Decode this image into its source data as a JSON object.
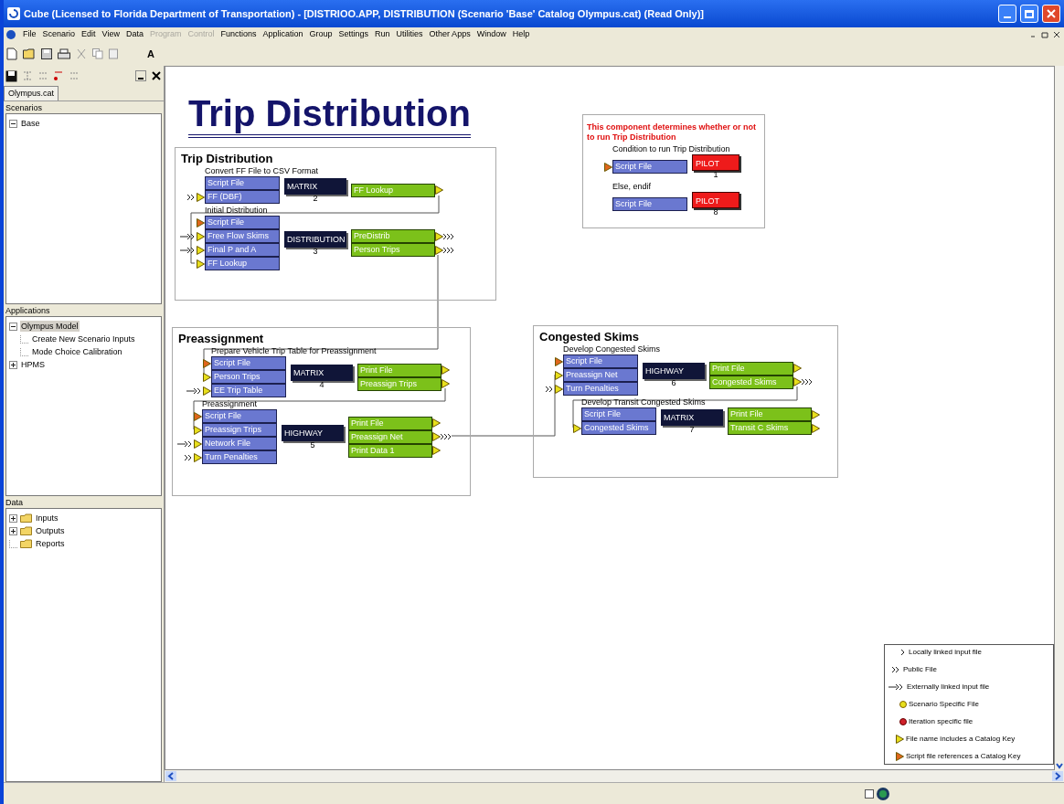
{
  "window": {
    "title": "Cube (Licensed to Florida Department of Transportation) - [DISTRIOO.APP, DISTRIBUTION (Scenario 'Base' Catalog Olympus.cat) (Read Only)]"
  },
  "menu": [
    {
      "label": "File",
      "disabled": false
    },
    {
      "label": "Scenario",
      "disabled": false
    },
    {
      "label": "Edit",
      "disabled": false
    },
    {
      "label": "View",
      "disabled": false
    },
    {
      "label": "Data",
      "disabled": false
    },
    {
      "label": "Program",
      "disabled": true
    },
    {
      "label": "Control",
      "disabled": true
    },
    {
      "label": "Functions",
      "disabled": false
    },
    {
      "label": "Application",
      "disabled": false
    },
    {
      "label": "Group",
      "disabled": false
    },
    {
      "label": "Settings",
      "disabled": false
    },
    {
      "label": "Run",
      "disabled": false
    },
    {
      "label": "Utilities",
      "disabled": false
    },
    {
      "label": "Other Apps",
      "disabled": false
    },
    {
      "label": "Window",
      "disabled": false
    },
    {
      "label": "Help",
      "disabled": false
    }
  ],
  "toolbar": {
    "font_button": "A"
  },
  "side_panel": {
    "tab": "Olympus.cat",
    "sections": [
      {
        "title": "Scenarios",
        "items": [
          {
            "label": "Base",
            "expanded": true,
            "selected": false
          }
        ]
      },
      {
        "title": "Applications",
        "items": [
          {
            "label": "Olympus Model",
            "expanded": true,
            "selected": true,
            "children": [
              {
                "label": "Create New Scenario Inputs",
                "selected": false
              },
              {
                "label": "Mode Choice Calibration",
                "selected": false
              }
            ]
          },
          {
            "label": "HPMS",
            "expanded": false,
            "selected": false
          }
        ]
      },
      {
        "title": "Data",
        "items": [
          {
            "label": "Inputs",
            "expanded": false,
            "selected": false
          },
          {
            "label": "Outputs",
            "expanded": false,
            "selected": false
          },
          {
            "label": "Reports",
            "selected": false
          }
        ]
      }
    ]
  },
  "canvas": {
    "title": "Trip Distribution",
    "groups": [
      {
        "title": "Trip Distribution",
        "steps": [
          {
            "caption": "Convert FF File to CSV Format",
            "inputs": [
              {
                "label": "Script File",
                "kind": "none"
              },
              {
                "label": "FF (DBF)",
                "kind": "public-key"
              }
            ],
            "program": {
              "name": "MATRIX",
              "number": "2",
              "kind": "process"
            },
            "outputs": [
              {
                "label": "FF Lookup",
                "kind": "key"
              }
            ]
          },
          {
            "caption": "Initial Distribution",
            "inputs": [
              {
                "label": "Script File",
                "kind": "script"
              },
              {
                "label": "Free Flow Skims",
                "kind": "external-key"
              },
              {
                "label": "Final P and A",
                "kind": "external-key"
              },
              {
                "label": "FF Lookup",
                "kind": "key"
              }
            ],
            "program": {
              "name": "DISTRIBUTION",
              "number": "3",
              "kind": "process"
            },
            "outputs": [
              {
                "label": "PreDistrib",
                "kind": "key-public"
              },
              {
                "label": "Person Trips",
                "kind": "key-public"
              }
            ]
          }
        ]
      },
      {
        "title": "Preassignment",
        "steps": [
          {
            "caption": "Prepare Vehicle Trip Table for Preassignment",
            "inputs": [
              {
                "label": "Script File",
                "kind": "script"
              },
              {
                "label": "Person Trips",
                "kind": "key"
              },
              {
                "label": "EE Trip Table",
                "kind": "external-key"
              }
            ],
            "program": {
              "name": "MATRIX",
              "number": "4",
              "kind": "process"
            },
            "outputs": [
              {
                "label": "Print File",
                "kind": "key"
              },
              {
                "label": "Preassign Trips",
                "kind": "key"
              }
            ]
          },
          {
            "caption": "Preassignment",
            "inputs": [
              {
                "label": "Script File",
                "kind": "script"
              },
              {
                "label": "Preassign Trips",
                "kind": "key"
              },
              {
                "label": "Network File",
                "kind": "external-key"
              },
              {
                "label": "Turn Penalties",
                "kind": "public-key"
              }
            ],
            "program": {
              "name": "HIGHWAY",
              "number": "5",
              "kind": "process"
            },
            "outputs": [
              {
                "label": "Print File",
                "kind": "key"
              },
              {
                "label": "Preassign Net",
                "kind": "key-public"
              },
              {
                "label": "Print Data 1",
                "kind": "key"
              }
            ]
          }
        ]
      },
      {
        "title": "Congested Skims",
        "steps": [
          {
            "caption": "Develop Congested Skims",
            "inputs": [
              {
                "label": "Script File",
                "kind": "script"
              },
              {
                "label": "Preassign Net",
                "kind": "key"
              },
              {
                "label": "Turn Penalties",
                "kind": "public-key"
              }
            ],
            "program": {
              "name": "HIGHWAY",
              "number": "6",
              "kind": "process"
            },
            "outputs": [
              {
                "label": "Print File",
                "kind": "key"
              },
              {
                "label": "Congested Skims",
                "kind": "key-public"
              }
            ]
          },
          {
            "caption": "Develop Transit Congested Skims",
            "inputs": [
              {
                "label": "Script File",
                "kind": "none"
              },
              {
                "label": "Congested Skims",
                "kind": "key"
              }
            ],
            "program": {
              "name": "MATRIX",
              "number": "7",
              "kind": "process"
            },
            "outputs": [
              {
                "label": "Print File",
                "kind": "key"
              },
              {
                "label": "Transit C Skims",
                "kind": "key"
              }
            ]
          }
        ]
      }
    ],
    "condition": {
      "note": "This component determines whether or not to run Trip Distribution",
      "steps": [
        {
          "caption": "Condition to run Trip Distribution",
          "inputs": [
            {
              "label": "Script File",
              "kind": "script"
            }
          ],
          "program": {
            "name": "PILOT",
            "number": "1",
            "kind": "control"
          }
        },
        {
          "caption": "Else, endif",
          "inputs": [
            {
              "label": "Script File",
              "kind": "none"
            }
          ],
          "program": {
            "name": "PILOT",
            "number": "8",
            "kind": "control"
          }
        }
      ]
    },
    "legend": [
      {
        "kind": "local",
        "label": "Locally linked input file"
      },
      {
        "kind": "public",
        "label": "Public File"
      },
      {
        "kind": "external",
        "label": "Externally linked input file"
      },
      {
        "kind": "scenario",
        "label": "Scenario Specific File"
      },
      {
        "kind": "iteration",
        "label": "Iteration specific file"
      },
      {
        "kind": "catalog",
        "label": "File name includes a Catalog Key"
      },
      {
        "kind": "script",
        "label": "Script file references a Catalog Key"
      }
    ]
  }
}
